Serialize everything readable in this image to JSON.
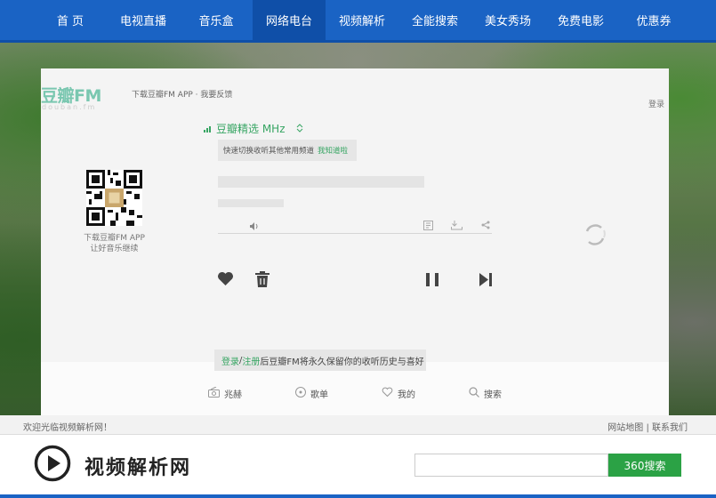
{
  "nav": {
    "items": [
      {
        "label": "首 页"
      },
      {
        "label": "电视直播"
      },
      {
        "label": "音乐盒"
      },
      {
        "label": "网络电台",
        "active": true
      },
      {
        "label": "视频解析"
      },
      {
        "label": "全能搜索"
      },
      {
        "label": "美女秀场"
      },
      {
        "label": "免费电影"
      },
      {
        "label": "优惠券"
      }
    ]
  },
  "player": {
    "logo": "豆瓣FM",
    "logo_sub": "douban.fm",
    "top_links": "下载豆瓣FM APP · 我要反馈",
    "login": "登录",
    "qr_line1": "下载豆瓣FM APP",
    "qr_line2": "让好音乐继续",
    "channel": "豆瓣精选 MHz",
    "tip_text": "快速切换收听其他常用频道",
    "tip_link": "我知道啦",
    "save_login": "登录",
    "save_sep": " / ",
    "save_register": "注册",
    "save_text": " 后豆瓣FM将永久保留你的收听历史与喜好",
    "tabs": [
      {
        "label": "兆赫",
        "icon": "radio-icon"
      },
      {
        "label": "歌单",
        "icon": "disc-icon"
      },
      {
        "label": "我的",
        "icon": "heart-outline-icon"
      },
      {
        "label": "搜索",
        "icon": "search-icon"
      }
    ]
  },
  "footer": {
    "welcome": "欢迎光临视频解析网！",
    "sitemap": "网站地图",
    "divider": " | ",
    "contact": "联系我们"
  },
  "site": {
    "title": "视频解析网",
    "search_button": "360搜索",
    "search_value": ""
  },
  "colors": {
    "nav_bg": "#1a63c4",
    "accent_green": "#37a563",
    "search_btn": "#2ba245"
  }
}
